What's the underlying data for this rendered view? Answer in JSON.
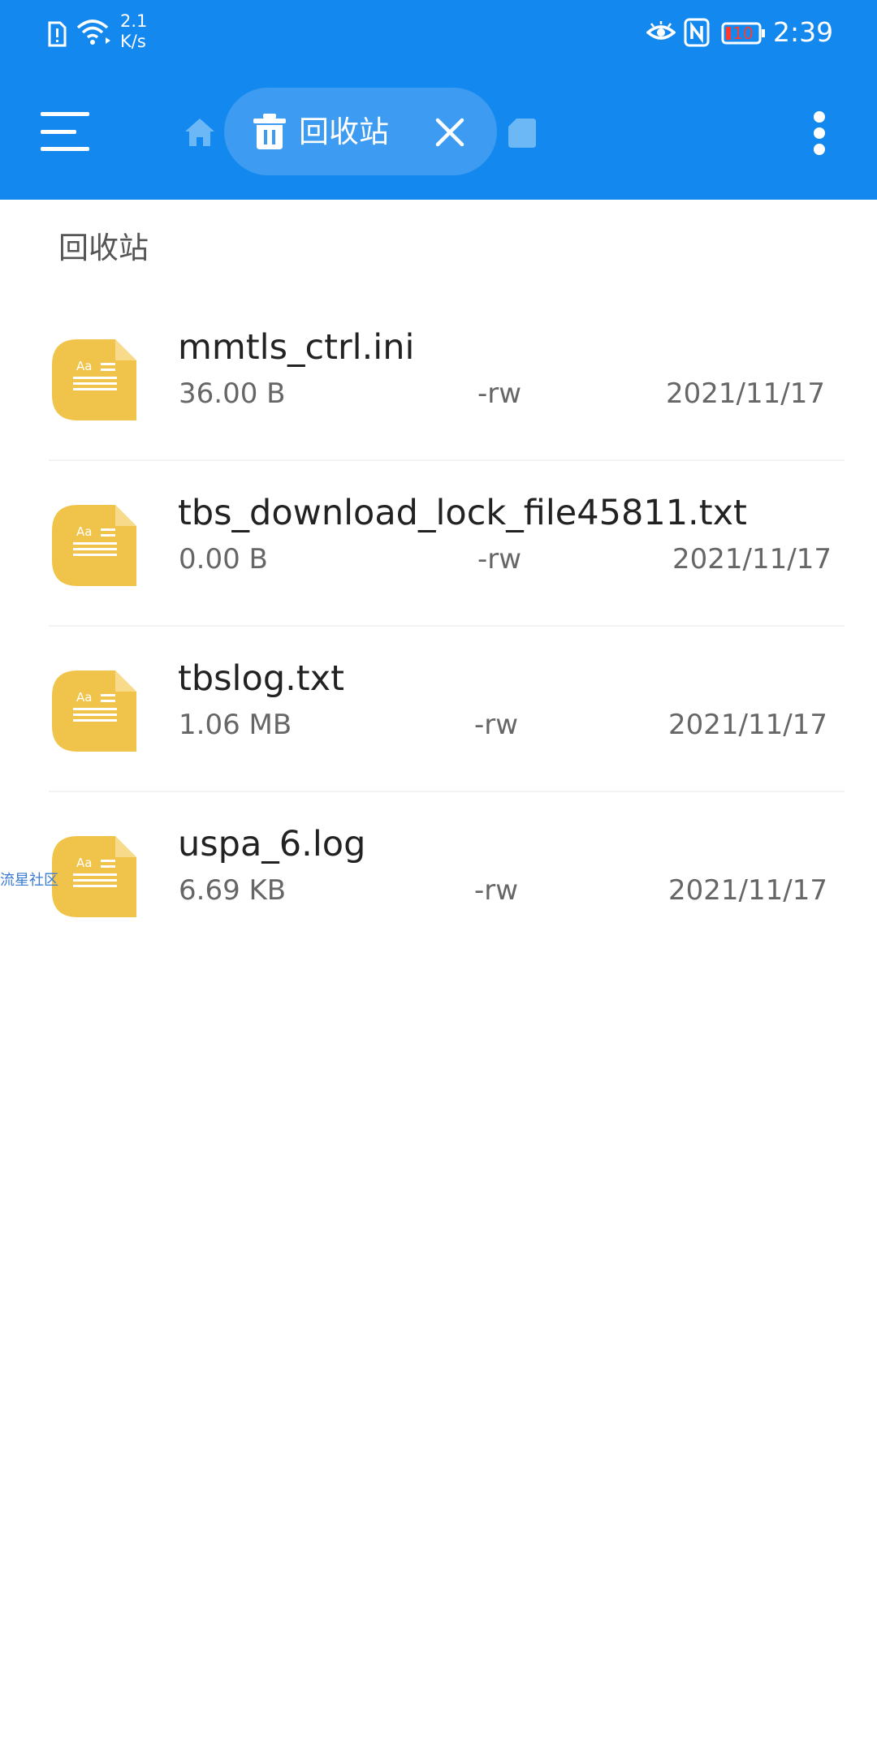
{
  "status_bar": {
    "net_speed_value": "2.1",
    "net_speed_unit": "K/s",
    "battery": "10",
    "time": "2:39"
  },
  "toolbar": {
    "tab_label": "回收站",
    "icons": [
      "menu-icon",
      "home-icon",
      "trash-icon",
      "close-icon",
      "sd-card-icon",
      "more-vert-icon"
    ]
  },
  "section": {
    "title": "回收站"
  },
  "files": [
    {
      "name": "mmtls_ctrl.ini",
      "size": "36.00 B",
      "perm": "-rw",
      "date": "2021/11/17"
    },
    {
      "name": "tbs_download_lock_file45811.txt",
      "size": "0.00 B",
      "perm": "-rw",
      "date": "2021/11/17"
    },
    {
      "name": "tbslog.txt",
      "size": "1.06 MB",
      "perm": "-rw",
      "date": "2021/11/17"
    },
    {
      "name": "uspa_6.log",
      "size": "6.69 KB",
      "perm": "-rw",
      "date": "2021/11/17"
    }
  ],
  "watermark": "流星社区",
  "colors": {
    "app_bar": "#1388ee",
    "tab_pill": "#3d9cf1",
    "file_icon": "#f0c44b",
    "battery_low": "#ff3b30"
  }
}
